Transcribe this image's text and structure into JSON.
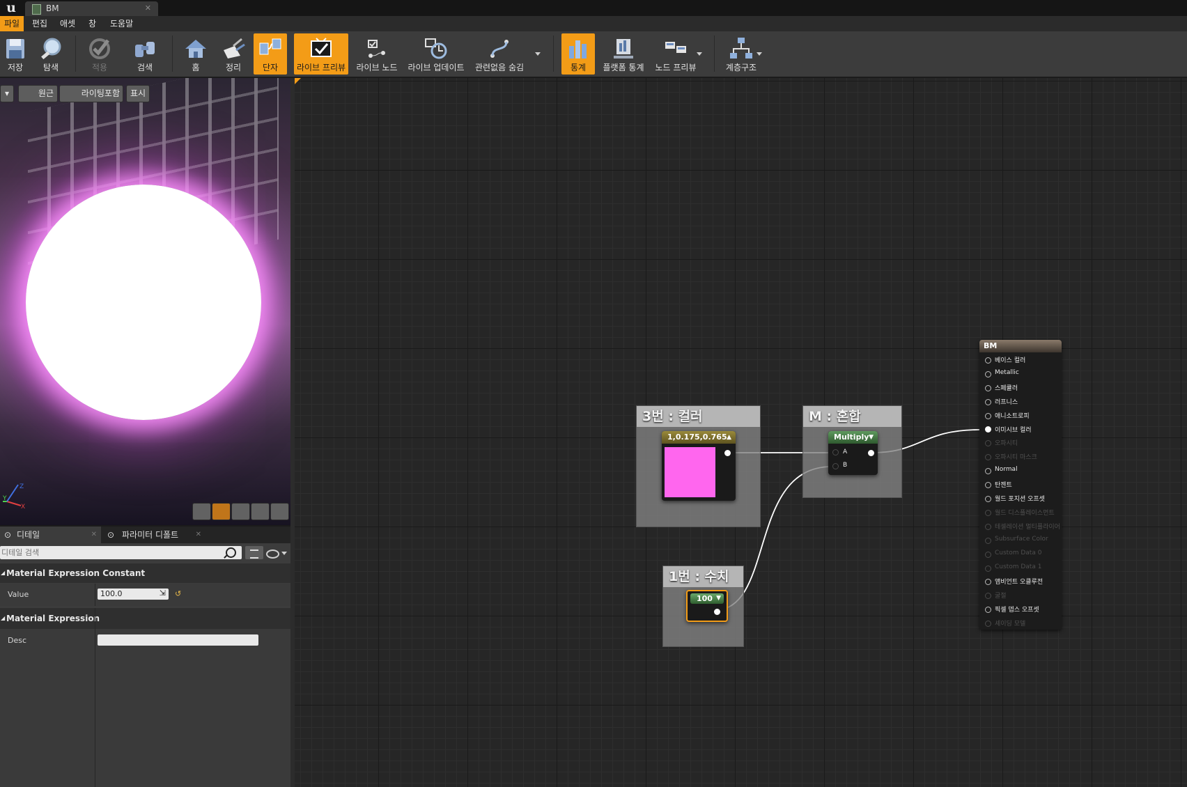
{
  "window": {
    "tab_title": "BM"
  },
  "menu": [
    "파일",
    "편집",
    "애셋",
    "창",
    "도움말"
  ],
  "toolbar": {
    "save": "저장",
    "browse": "탐색",
    "apply": "적용",
    "search": "검색",
    "home": "홈",
    "clean_up": "정리",
    "connectors": "단자",
    "live_preview": "라이브 프리뷰",
    "live_nodes": "라이브 노드",
    "live_update": "라이브 업데이트",
    "hide_unrelated": "관련없음 숨김",
    "stats": "통계",
    "platform_stats": "플랫폼 통계",
    "node_preview": "노드 프리뷰",
    "hierarchy": "계층구조"
  },
  "viewport": {
    "perspective": "원근",
    "lit": "라이팅포함",
    "show": "표시",
    "axis_x": "X",
    "axis_y": "Y",
    "axis_z": "Z"
  },
  "panel_tabs": {
    "details": "디테일",
    "param_defaults": "파라미터 디폴트"
  },
  "details": {
    "search_placeholder": "디테일 검색",
    "category1": "Material Expression Constant",
    "value_label": "Value",
    "value": "100.0",
    "category2": "Material Expression",
    "desc_label": "Desc",
    "desc": ""
  },
  "graph": {
    "comment_color": "3번 : 컬러",
    "comment_multiply": "M : 혼합",
    "comment_scalar": "1번 : 수치",
    "color_node_title": "1,0.175,0.765",
    "color_swatch": "#ff66ee",
    "multiply_title": "Multiply",
    "multiply_a": "A",
    "multiply_b": "B",
    "scalar_title": "100",
    "result_title": "BM",
    "result_pins": [
      {
        "label": "베이스 컬러",
        "enabled": true
      },
      {
        "label": "Metallic",
        "enabled": true
      },
      {
        "label": "스페큘러",
        "enabled": true
      },
      {
        "label": "러프니스",
        "enabled": true
      },
      {
        "label": "애니소트로피",
        "enabled": true
      },
      {
        "label": "이미시브 컬러",
        "enabled": true,
        "connected": true
      },
      {
        "label": "오파시티",
        "enabled": false
      },
      {
        "label": "오파시티 마스크",
        "enabled": false
      },
      {
        "label": "Normal",
        "enabled": true
      },
      {
        "label": "탄젠트",
        "enabled": true
      },
      {
        "label": "월드 포지션 오프셋",
        "enabled": true
      },
      {
        "label": "월드 디스플레이스먼트",
        "enabled": false
      },
      {
        "label": "테셀레이션 멀티플라이어",
        "enabled": false
      },
      {
        "label": "Subsurface Color",
        "enabled": false
      },
      {
        "label": "Custom Data 0",
        "enabled": false
      },
      {
        "label": "Custom Data 1",
        "enabled": false
      },
      {
        "label": "앰비언트 오클루전",
        "enabled": true
      },
      {
        "label": "굴절",
        "enabled": false
      },
      {
        "label": "픽셀 뎁스 오프셋",
        "enabled": true
      },
      {
        "label": "셰이딩 모델",
        "enabled": false
      }
    ]
  },
  "colors": {
    "accent": "#f39c17",
    "node_bg": "#1a1a1a",
    "wire": "#ffffff"
  }
}
